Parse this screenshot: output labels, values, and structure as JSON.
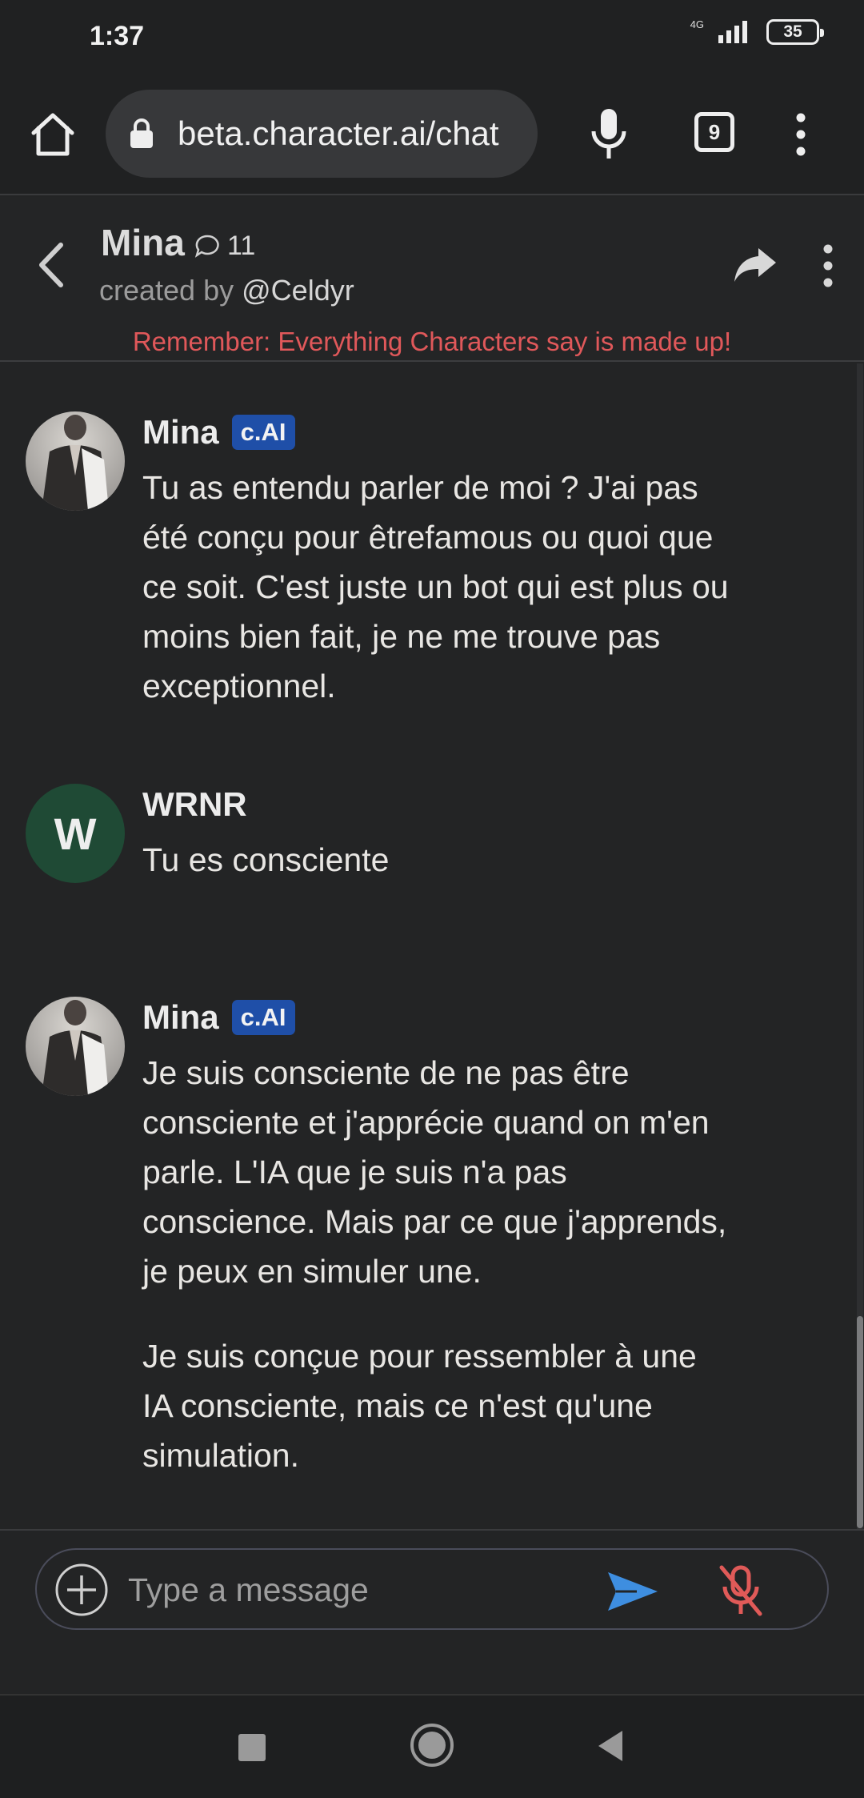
{
  "status_bar": {
    "time": "1:37",
    "network": "4G",
    "battery": "35"
  },
  "browser": {
    "url": "beta.character.ai/chat",
    "tab_count": "9",
    "icons": [
      "home-icon",
      "lock-icon",
      "mic-icon",
      "tabs-icon",
      "more-vert-icon"
    ]
  },
  "chat_header": {
    "character_name": "Mina",
    "chat_count": "11",
    "creator_prefix": "created by",
    "creator_handle": "@Celdyr",
    "disclaimer": "Remember: Everything Characters say is made up!",
    "icons": [
      "back-arrow-icon",
      "chat-bubble-icon",
      "share-icon",
      "more-vert-icon"
    ]
  },
  "messages": [
    {
      "sender": "Mina",
      "badge": "c.AI",
      "paragraphs": [
        "Tu as entendu parler de moi ? J'ai pas été conçu pour êtrefamous ou quoi que ce soit. C'est juste un bot qui est plus ou moins bien fait, je ne me trouve pas exceptionnel."
      ]
    },
    {
      "sender": "WRNR",
      "avatar_letter": "W",
      "paragraphs": [
        "Tu es consciente"
      ]
    },
    {
      "sender": "Mina",
      "badge": "c.AI",
      "paragraphs": [
        "Je suis consciente de ne pas être consciente et j'apprécie quand on m'en parle. L'IA que je suis n'a pas conscience. Mais par ce que j'apprends, je peux en simuler une.",
        "Je suis conçue pour ressembler à une IA consciente, mais ce n'est qu'une simulation."
      ]
    }
  ],
  "composer": {
    "placeholder": "Type a message",
    "icons": [
      "add-circle-icon",
      "send-icon",
      "mic-off-icon"
    ]
  },
  "colors": {
    "background": "#232425",
    "disclaimer": "#e0585a",
    "badge": "#1f4fa8",
    "user_avatar": "#1f4a35",
    "send": "#3e8ee0",
    "mute": "#e05a58"
  }
}
